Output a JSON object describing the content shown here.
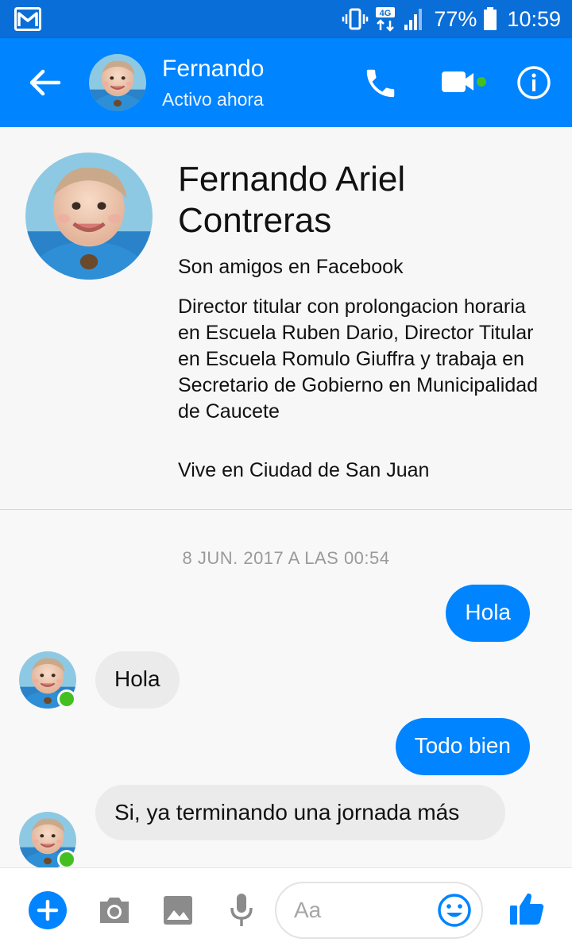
{
  "status_bar": {
    "network": "4G",
    "battery": "77%",
    "time": "10:59"
  },
  "header": {
    "name": "Fernando",
    "status": "Activo ahora"
  },
  "profile": {
    "full_name": "Fernando Ariel Contreras",
    "friendship": "Son amigos en Facebook",
    "work": "Director titular con prolongacion horaria en Escuela Ruben Dario, Director Titular en Escuela Romulo Giuffra y trabaja en Secretario de Gobierno en Municipalidad de Caucete",
    "lives": "Vive en Ciudad de San Juan"
  },
  "conversation": {
    "timestamp": "8 JUN. 2017 A LAS 00:54",
    "messages": [
      {
        "from": "me",
        "text": "Hola"
      },
      {
        "from": "them",
        "text": "Hola"
      },
      {
        "from": "me",
        "text": "Todo bien"
      },
      {
        "from": "them",
        "text": "Si, ya terminando una jornada más"
      }
    ]
  },
  "composer": {
    "placeholder": "Aa"
  },
  "colors": {
    "accent": "#0084ff",
    "status_bar": "#0a6ed8",
    "online": "#44bf20",
    "incoming_bubble": "#ebebeb"
  },
  "icons": [
    "gmail-icon",
    "vibrate-icon",
    "network-4g-icon",
    "signal-icon",
    "battery-icon",
    "back-arrow-icon",
    "phone-icon",
    "video-camera-icon",
    "info-icon",
    "plus-icon",
    "camera-icon",
    "gallery-icon",
    "microphone-icon",
    "emoji-icon",
    "thumbs-up-icon"
  ]
}
